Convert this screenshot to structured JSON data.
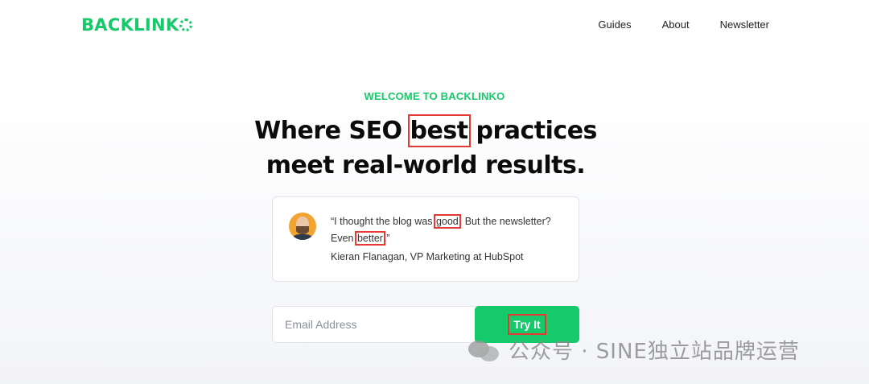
{
  "header": {
    "logo_text": "BACKLINK",
    "nav": [
      {
        "label": "Guides"
      },
      {
        "label": "About"
      },
      {
        "label": "Newsletter"
      }
    ]
  },
  "hero": {
    "eyebrow": "WELCOME TO BACKLINKO",
    "headline_part1": "Where SEO ",
    "headline_highlight": "best",
    "headline_part2": " practices",
    "headline_line2": "meet real-world results."
  },
  "testimonial": {
    "q1": "“I thought the blog was ",
    "q_good": "good",
    "q2": ". But the newsletter? Even ",
    "q_better": "better",
    "q3": ".”",
    "author": "Kieran Flanagan, VP Marketing at HubSpot",
    "avatar_icon": "person-avatar"
  },
  "signup": {
    "email_placeholder": "Email Address",
    "email_value": "",
    "button_label": "Try It"
  },
  "watermark": {
    "text": "公众号 · SINE独立站品牌运营",
    "icon": "wechat-icon"
  },
  "colors": {
    "brand_green": "#16c96b",
    "annotation_red": "#e53935"
  }
}
